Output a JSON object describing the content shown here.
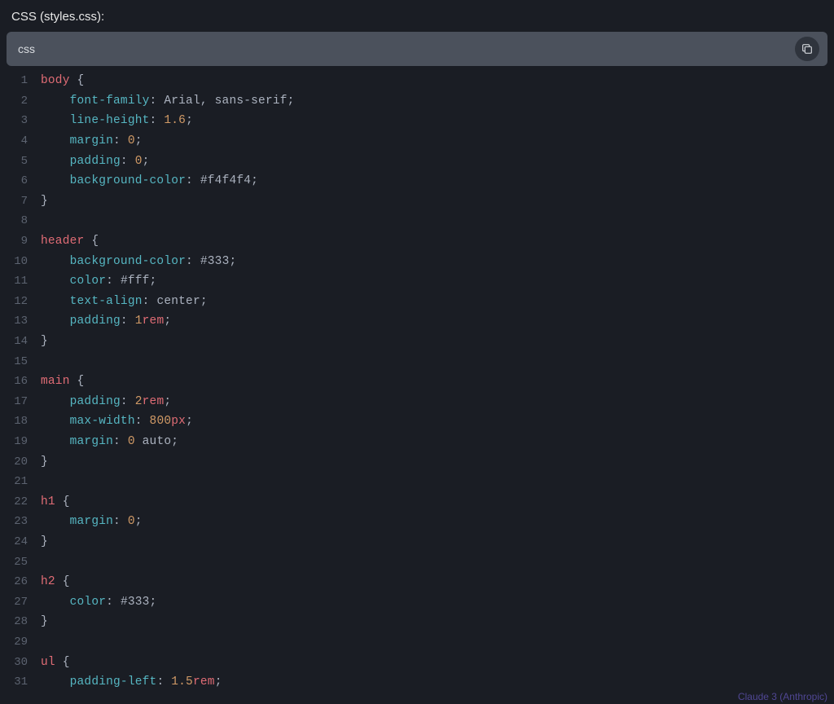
{
  "header": {
    "title": "CSS (styles.css):"
  },
  "toolbar": {
    "language": "css"
  },
  "footer": {
    "brand": "Claude 3 (Anthropic)"
  },
  "code": {
    "lines": [
      [
        {
          "t": "sel",
          "v": "body"
        },
        {
          "t": "punc",
          "v": " {"
        }
      ],
      [
        {
          "t": "pad",
          "v": "    "
        },
        {
          "t": "prop",
          "v": "font-family"
        },
        {
          "t": "punc",
          "v": ": "
        },
        {
          "t": "str",
          "v": "Arial, sans-serif"
        },
        {
          "t": "punc",
          "v": ";"
        }
      ],
      [
        {
          "t": "pad",
          "v": "    "
        },
        {
          "t": "prop",
          "v": "line-height"
        },
        {
          "t": "punc",
          "v": ": "
        },
        {
          "t": "num",
          "v": "1.6"
        },
        {
          "t": "punc",
          "v": ";"
        }
      ],
      [
        {
          "t": "pad",
          "v": "    "
        },
        {
          "t": "prop",
          "v": "margin"
        },
        {
          "t": "punc",
          "v": ": "
        },
        {
          "t": "num",
          "v": "0"
        },
        {
          "t": "punc",
          "v": ";"
        }
      ],
      [
        {
          "t": "pad",
          "v": "    "
        },
        {
          "t": "prop",
          "v": "padding"
        },
        {
          "t": "punc",
          "v": ": "
        },
        {
          "t": "num",
          "v": "0"
        },
        {
          "t": "punc",
          "v": ";"
        }
      ],
      [
        {
          "t": "pad",
          "v": "    "
        },
        {
          "t": "prop",
          "v": "background-color"
        },
        {
          "t": "punc",
          "v": ": "
        },
        {
          "t": "str",
          "v": "#f4f4f4"
        },
        {
          "t": "punc",
          "v": ";"
        }
      ],
      [
        {
          "t": "punc",
          "v": "}"
        }
      ],
      [],
      [
        {
          "t": "sel",
          "v": "header"
        },
        {
          "t": "punc",
          "v": " {"
        }
      ],
      [
        {
          "t": "pad",
          "v": "    "
        },
        {
          "t": "prop",
          "v": "background-color"
        },
        {
          "t": "punc",
          "v": ": "
        },
        {
          "t": "str",
          "v": "#333"
        },
        {
          "t": "punc",
          "v": ";"
        }
      ],
      [
        {
          "t": "pad",
          "v": "    "
        },
        {
          "t": "prop",
          "v": "color"
        },
        {
          "t": "punc",
          "v": ": "
        },
        {
          "t": "str",
          "v": "#fff"
        },
        {
          "t": "punc",
          "v": ";"
        }
      ],
      [
        {
          "t": "pad",
          "v": "    "
        },
        {
          "t": "prop",
          "v": "text-align"
        },
        {
          "t": "punc",
          "v": ": "
        },
        {
          "t": "str",
          "v": "center"
        },
        {
          "t": "punc",
          "v": ";"
        }
      ],
      [
        {
          "t": "pad",
          "v": "    "
        },
        {
          "t": "prop",
          "v": "padding"
        },
        {
          "t": "punc",
          "v": ": "
        },
        {
          "t": "num",
          "v": "1"
        },
        {
          "t": "unit",
          "v": "rem"
        },
        {
          "t": "punc",
          "v": ";"
        }
      ],
      [
        {
          "t": "punc",
          "v": "}"
        }
      ],
      [],
      [
        {
          "t": "sel",
          "v": "main"
        },
        {
          "t": "punc",
          "v": " {"
        }
      ],
      [
        {
          "t": "pad",
          "v": "    "
        },
        {
          "t": "prop",
          "v": "padding"
        },
        {
          "t": "punc",
          "v": ": "
        },
        {
          "t": "num",
          "v": "2"
        },
        {
          "t": "unit",
          "v": "rem"
        },
        {
          "t": "punc",
          "v": ";"
        }
      ],
      [
        {
          "t": "pad",
          "v": "    "
        },
        {
          "t": "prop",
          "v": "max-width"
        },
        {
          "t": "punc",
          "v": ": "
        },
        {
          "t": "num",
          "v": "800"
        },
        {
          "t": "unit",
          "v": "px"
        },
        {
          "t": "punc",
          "v": ";"
        }
      ],
      [
        {
          "t": "pad",
          "v": "    "
        },
        {
          "t": "prop",
          "v": "margin"
        },
        {
          "t": "punc",
          "v": ": "
        },
        {
          "t": "num",
          "v": "0"
        },
        {
          "t": "str",
          "v": " auto"
        },
        {
          "t": "punc",
          "v": ";"
        }
      ],
      [
        {
          "t": "punc",
          "v": "}"
        }
      ],
      [],
      [
        {
          "t": "sel",
          "v": "h1"
        },
        {
          "t": "punc",
          "v": " {"
        }
      ],
      [
        {
          "t": "pad",
          "v": "    "
        },
        {
          "t": "prop",
          "v": "margin"
        },
        {
          "t": "punc",
          "v": ": "
        },
        {
          "t": "num",
          "v": "0"
        },
        {
          "t": "punc",
          "v": ";"
        }
      ],
      [
        {
          "t": "punc",
          "v": "}"
        }
      ],
      [],
      [
        {
          "t": "sel",
          "v": "h2"
        },
        {
          "t": "punc",
          "v": " {"
        }
      ],
      [
        {
          "t": "pad",
          "v": "    "
        },
        {
          "t": "prop",
          "v": "color"
        },
        {
          "t": "punc",
          "v": ": "
        },
        {
          "t": "str",
          "v": "#333"
        },
        {
          "t": "punc",
          "v": ";"
        }
      ],
      [
        {
          "t": "punc",
          "v": "}"
        }
      ],
      [],
      [
        {
          "t": "sel",
          "v": "ul"
        },
        {
          "t": "punc",
          "v": " {"
        }
      ],
      [
        {
          "t": "pad",
          "v": "    "
        },
        {
          "t": "prop",
          "v": "padding-left"
        },
        {
          "t": "punc",
          "v": ": "
        },
        {
          "t": "num",
          "v": "1.5"
        },
        {
          "t": "unit",
          "v": "rem"
        },
        {
          "t": "punc",
          "v": ";"
        }
      ]
    ]
  }
}
